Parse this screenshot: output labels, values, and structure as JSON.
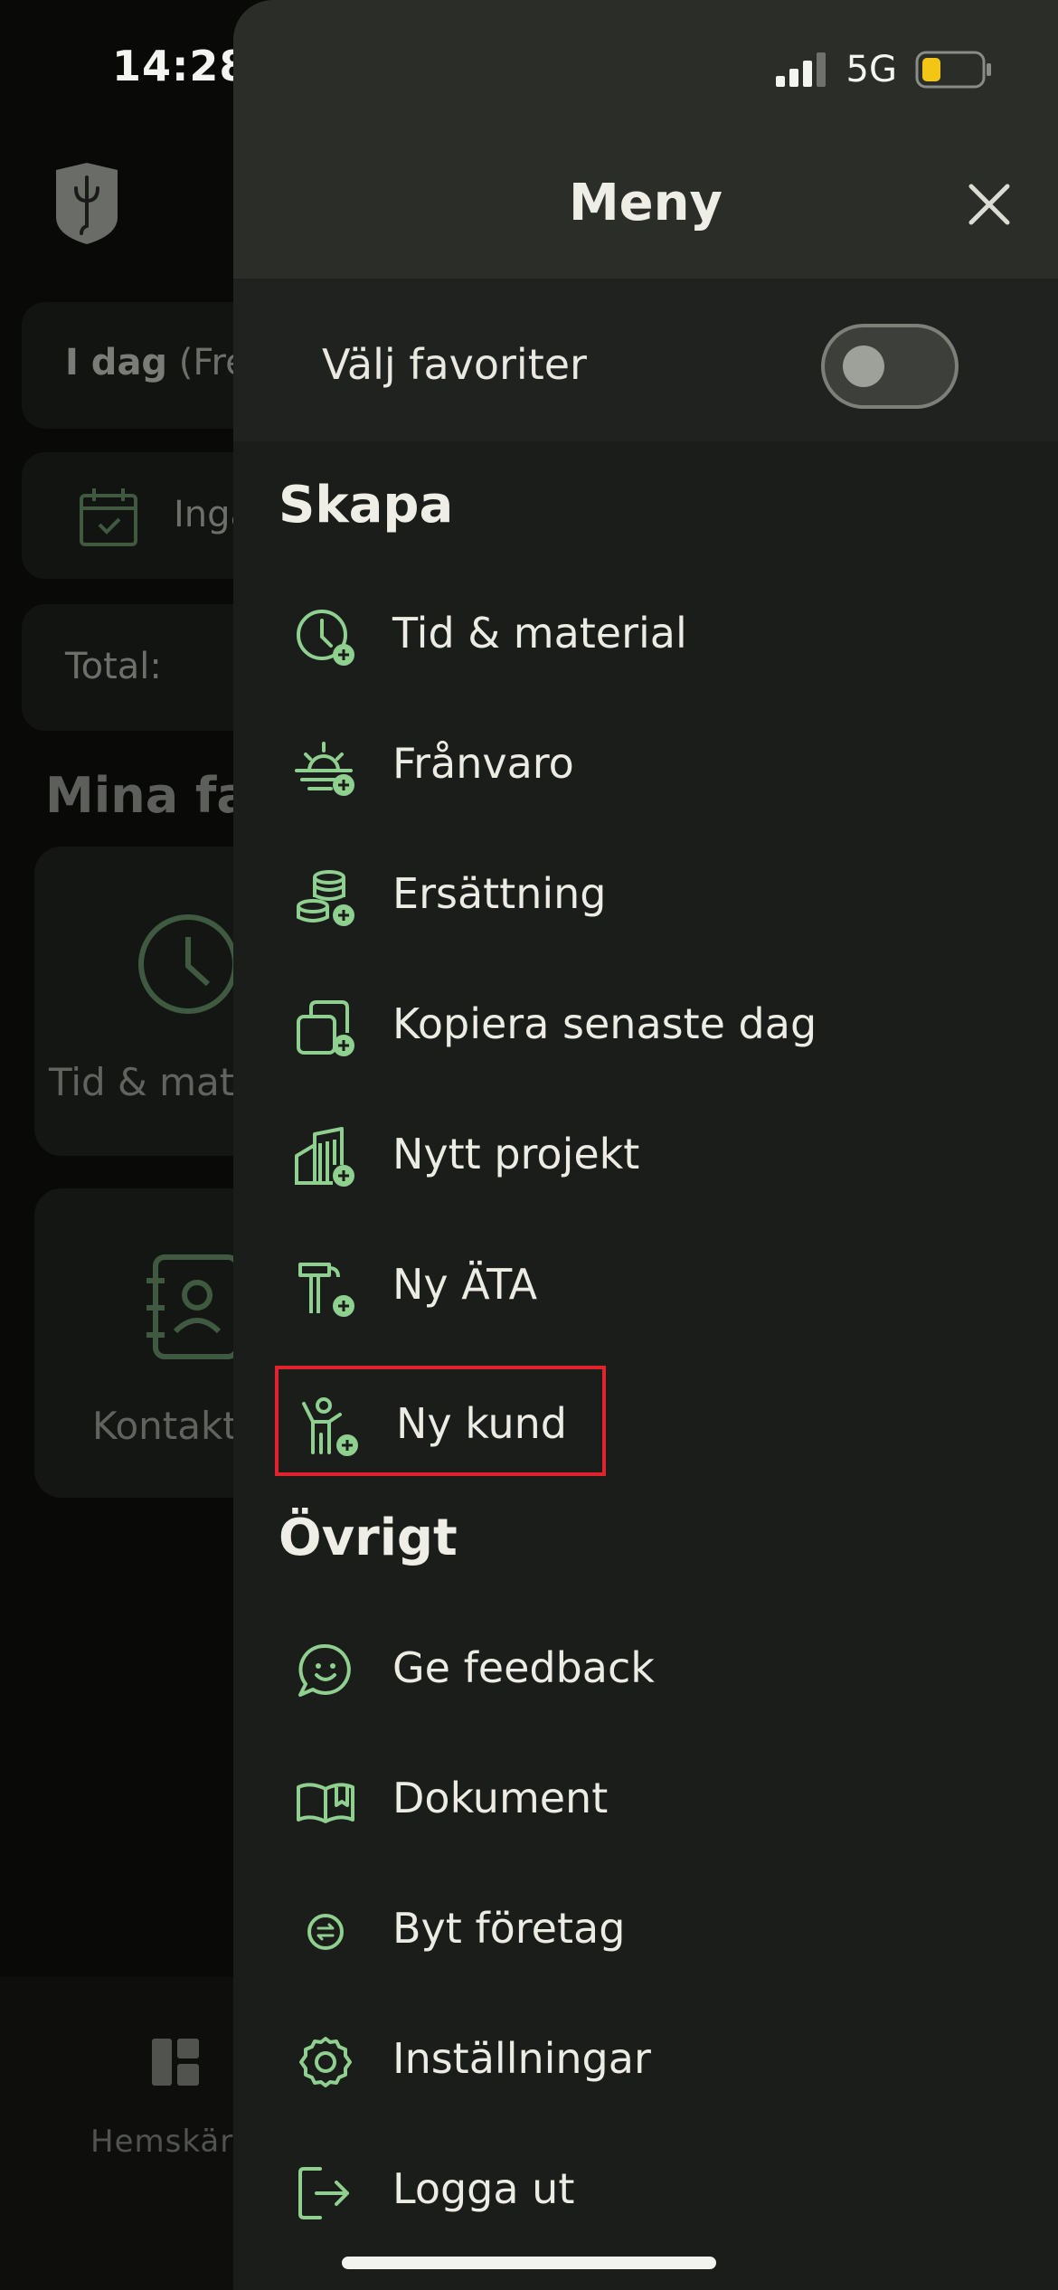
{
  "status_bar": {
    "time": "14:28",
    "network": "5G"
  },
  "background": {
    "today_label": "I dag",
    "today_suffix": "(Fre",
    "empty_text": "Inga",
    "total_label": "Total:",
    "favorites_title": "Mina fa",
    "fav_tile_1": "Tid & mat",
    "fav_tile_2": "Kontakt",
    "tab_home": "Hemskär"
  },
  "drawer": {
    "title": "Meny",
    "favorites_toggle_label": "Välj favoriter",
    "favorites_toggle_on": false
  },
  "create_section": {
    "title": "Skapa",
    "items": [
      {
        "label": "Tid & material",
        "icon": "clock-plus-icon"
      },
      {
        "label": "Frånvaro",
        "icon": "sunrise-plus-icon"
      },
      {
        "label": "Ersättning",
        "icon": "coins-plus-icon"
      },
      {
        "label": "Kopiera senaste dag",
        "icon": "copy-plus-icon"
      },
      {
        "label": "Nytt projekt",
        "icon": "buildings-plus-icon"
      },
      {
        "label": "Ny ÄTA",
        "icon": "tools-plus-icon"
      },
      {
        "label": "Ny kund",
        "icon": "person-plus-icon",
        "highlighted": true
      }
    ]
  },
  "other_section": {
    "title": "Övrigt",
    "items": [
      {
        "label": "Ge feedback",
        "icon": "chat-smile-icon"
      },
      {
        "label": "Dokument",
        "icon": "book-open-icon"
      },
      {
        "label": "Byt företag",
        "icon": "swap-circle-icon"
      },
      {
        "label": "Inställningar",
        "icon": "gear-icon"
      },
      {
        "label": "Logga ut",
        "icon": "logout-icon"
      }
    ]
  },
  "colors": {
    "accent_green": "#8fcf8f",
    "highlight_red": "#e0232c",
    "drawer_bg": "#1b1d1a",
    "header_bg": "#2a2d28",
    "battery_yellow": "#f3c615"
  }
}
